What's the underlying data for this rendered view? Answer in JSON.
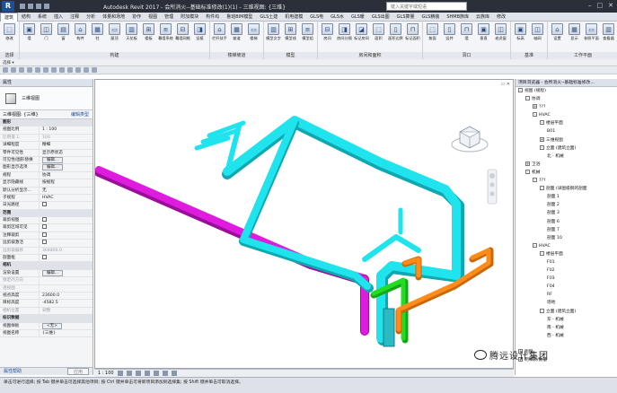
{
  "window": {
    "title": "Autodesk Revit 2017 -     会所消火--基础标准修改(1)(1) - 三维视图: {三维}",
    "search_placeholder": "键入关键字或短语",
    "app_icon": "R"
  },
  "tabs": [
    "建筑",
    "结构",
    "系统",
    "插入",
    "注释",
    "分析",
    "体量和场地",
    "协作",
    "视图",
    "管理",
    "附加模块",
    "构件坞",
    "鲁班BIM模型",
    "GLS土建",
    "机电建模",
    "GLS电",
    "GLS水",
    "GLS暖",
    "GLS出图",
    "GLS算量",
    "GLS精装",
    "SHMB族库",
    "云族库",
    "修改"
  ],
  "active_tab": "建筑",
  "ribbon_groups": [
    {
      "label": "选择",
      "buttons": [
        "修改"
      ]
    },
    {
      "label": "构建",
      "buttons": [
        "墙",
        "门",
        "窗",
        "构件",
        "柱",
        "屋顶",
        "天花板",
        "楼板",
        "幕墙系统",
        "幕墙网格",
        "竖梃"
      ]
    },
    {
      "label": "楼梯坡道",
      "buttons": [
        "栏杆扶手",
        "坡道",
        "楼梯"
      ]
    },
    {
      "label": "模型",
      "buttons": [
        "模型文字",
        "模型线",
        "模型组"
      ]
    },
    {
      "label": "房间和面积",
      "buttons": [
        "房间",
        "房间分隔",
        "标记房间",
        "面积",
        "面积边界",
        "标记面积"
      ]
    },
    {
      "label": "洞口",
      "buttons": [
        "按面",
        "竖井",
        "墙",
        "垂直",
        "老虎窗"
      ]
    },
    {
      "label": "基准",
      "buttons": [
        "标高",
        "轴网"
      ]
    },
    {
      "label": "工作平面",
      "buttons": [
        "设置",
        "显示",
        "参照平面",
        "查看器"
      ]
    }
  ],
  "select_bar": [
    "选择 ▾"
  ],
  "properties": {
    "header": "属性",
    "type_name": "三维视图",
    "instance_label": "三维视图: {三维}",
    "edit_type": "编辑类型",
    "rows": [
      {
        "k": "图形",
        "v": "",
        "section": true
      },
      {
        "k": "视图比例",
        "v": "1 : 100"
      },
      {
        "k": "比例值 1:",
        "v": "100",
        "grey": true
      },
      {
        "k": "详细程度",
        "v": "精细"
      },
      {
        "k": "零件可见性",
        "v": "显示原状态"
      },
      {
        "k": "可见性/图形替换",
        "v": "编辑...",
        "btn": true
      },
      {
        "k": "图形显示选项",
        "v": "编辑...",
        "btn": true
      },
      {
        "k": "规程",
        "v": "协调"
      },
      {
        "k": "显示隐藏线",
        "v": "按规程"
      },
      {
        "k": "默认分析显示...",
        "v": "无"
      },
      {
        "k": "子规程",
        "v": "HVAC"
      },
      {
        "k": "日光路径",
        "v": "",
        "chk": true
      },
      {
        "k": "范围",
        "v": "",
        "section": true
      },
      {
        "k": "裁剪视图",
        "v": "",
        "chk": true
      },
      {
        "k": "裁剪区域可见",
        "v": "",
        "chk": true
      },
      {
        "k": "注释裁剪",
        "v": "",
        "chk": true
      },
      {
        "k": "远剪裁激活",
        "v": "",
        "chk": true
      },
      {
        "k": "远剪裁偏移",
        "v": "304800.0",
        "grey": true
      },
      {
        "k": "剖面框",
        "v": "",
        "chk": true
      },
      {
        "k": "相机",
        "v": "",
        "section": true
      },
      {
        "k": "渲染设置",
        "v": "编辑...",
        "btn": true
      },
      {
        "k": "锁定的方向",
        "v": "",
        "grey": true
      },
      {
        "k": "透视图",
        "v": "",
        "grey": true
      },
      {
        "k": "视点高度",
        "v": "23600.0"
      },
      {
        "k": "目标高度",
        "v": "-4582.5"
      },
      {
        "k": "相机位置",
        "v": "调整",
        "grey": true
      },
      {
        "k": "标识数据",
        "v": "",
        "section": true
      },
      {
        "k": "视图样板",
        "v": "<无>",
        "btn": true
      },
      {
        "k": "视图名称",
        "v": "{三维}"
      }
    ],
    "help": "属性帮助",
    "apply": "应用"
  },
  "browser": {
    "header": "项目浏览器 - 会所消火--基础标准修改...",
    "nodes": [
      {
        "t": "视图 (规程)",
        "d": 0,
        "tog": "-"
      },
      {
        "t": "协调",
        "d": 1,
        "tog": "-"
      },
      {
        "t": "???",
        "d": 2,
        "tog": "+"
      },
      {
        "t": "HVAC",
        "d": 2,
        "tog": "-"
      },
      {
        "t": "楼层平面",
        "d": 3,
        "tog": "-"
      },
      {
        "t": "B01",
        "d": 4
      },
      {
        "t": "三维视图",
        "d": 3,
        "tog": "+"
      },
      {
        "t": "立面 (建筑立面)",
        "d": 3,
        "tog": "-"
      },
      {
        "t": "北 - 机械",
        "d": 4
      },
      {
        "t": "卫浴",
        "d": 1,
        "tog": "+"
      },
      {
        "t": "机械",
        "d": 1,
        "tog": "-"
      },
      {
        "t": "???",
        "d": 2,
        "tog": "-"
      },
      {
        "t": "剖面 (详图级钢的剖面",
        "d": 3,
        "tog": "-"
      },
      {
        "t": "剖面 1",
        "d": 4
      },
      {
        "t": "剖面 2",
        "d": 4
      },
      {
        "t": "剖面 3",
        "d": 4
      },
      {
        "t": "剖面 6",
        "d": 4
      },
      {
        "t": "剖面 7",
        "d": 4
      },
      {
        "t": "剖面 10",
        "d": 4
      },
      {
        "t": "HVAC",
        "d": 2,
        "tog": "-"
      },
      {
        "t": "楼层平面",
        "d": 3,
        "tog": "-"
      },
      {
        "t": "F01",
        "d": 4
      },
      {
        "t": "F02",
        "d": 4
      },
      {
        "t": "F03",
        "d": 4
      },
      {
        "t": "F04",
        "d": 4
      },
      {
        "t": "RF",
        "d": 4
      },
      {
        "t": "场地",
        "d": 4
      },
      {
        "t": "立面 (建筑立面)",
        "d": 3,
        "tog": "-"
      },
      {
        "t": "东 - 机械",
        "d": 4
      },
      {
        "t": "南 - 机械",
        "d": 4
      },
      {
        "t": "西 - 机械",
        "d": 4
      },
      {
        "t": "",
        "d": 4
      },
      {
        "t": "图例",
        "d": 0,
        "tog": "+"
      },
      {
        "t": "明细表/数量",
        "d": 0,
        "tog": "+"
      }
    ]
  },
  "viewbar": {
    "scale": "1 : 100"
  },
  "status_text": "单击可进行选择; 按 Tab 键并单击可选择其他项目; 按 Ctrl 键并单击可将新项目添加到选择集; 按 Shift 键并单击可取消选择。",
  "watermark": "腾远设计集团",
  "colors": {
    "duct_cyan": "#1fe4ee",
    "duct_magenta": "#e01be0",
    "duct_green": "#22dd22",
    "duct_orange": "#ff8c1a",
    "duct_teal": "#2bb9c4"
  }
}
